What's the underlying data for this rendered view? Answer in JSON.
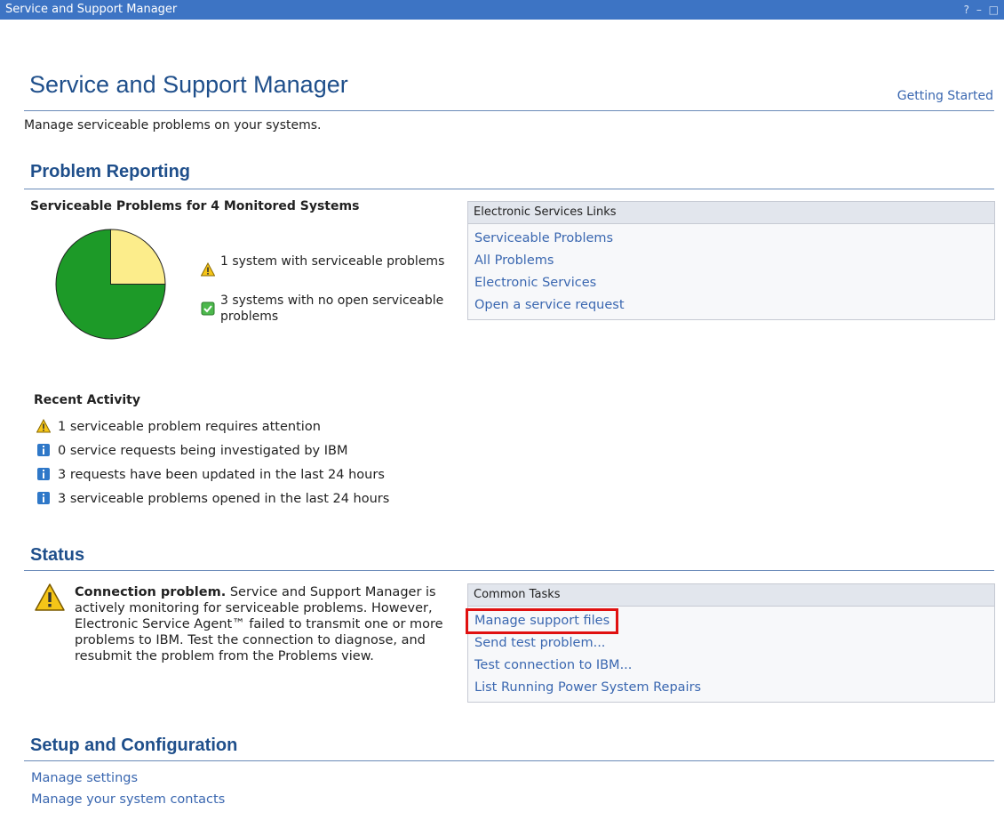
{
  "window": {
    "title": "Service and Support Manager",
    "controls": "? – □"
  },
  "header": {
    "title": "Service and Support Manager",
    "getting_started": "Getting Started",
    "subtitle": "Manage serviceable problems on your systems."
  },
  "problem_reporting": {
    "heading": "Problem Reporting",
    "chart_title": "Serviceable Problems for 4 Monitored Systems",
    "chart_data": {
      "type": "pie",
      "categories": [
        "1 system with serviceable problems",
        "3 systems with no open serviceable problems"
      ],
      "values": [
        1,
        3
      ],
      "colors": [
        "#fced8b",
        "#1d9a28"
      ]
    },
    "legend": [
      {
        "icon": "warning-icon",
        "text": "1 system with serviceable problems"
      },
      {
        "icon": "check-icon",
        "text": "3 systems with no open serviceable problems"
      }
    ],
    "links_panel": {
      "title": "Electronic Services Links",
      "links": [
        "Serviceable Problems",
        "All Problems",
        "Electronic Services",
        "Open a service request"
      ]
    }
  },
  "recent_activity": {
    "heading": "Recent Activity",
    "items": [
      {
        "icon": "warning-icon",
        "text": "1 serviceable problem requires attention"
      },
      {
        "icon": "info-icon",
        "text": "0 service requests being investigated by IBM"
      },
      {
        "icon": "info-icon",
        "text": "3 requests have been updated in the last 24 hours"
      },
      {
        "icon": "info-icon",
        "text": "3 serviceable problems opened in the last 24 hours"
      }
    ]
  },
  "status": {
    "heading": "Status",
    "message_title": "Connection problem.",
    "message_body": "Service and Support Manager is actively monitoring for serviceable problems. However, Electronic Service Agent™ failed to transmit one or more problems to IBM. Test the connection to diagnose, and resubmit the problem from the Problems view.",
    "tasks_panel": {
      "title": "Common Tasks",
      "links": [
        "Manage support files",
        "Send test problem...",
        "Test connection to IBM...",
        "List Running Power System Repairs"
      ]
    }
  },
  "setup": {
    "heading": "Setup and Configuration",
    "links": [
      "Manage settings",
      "Manage your system contacts"
    ]
  }
}
